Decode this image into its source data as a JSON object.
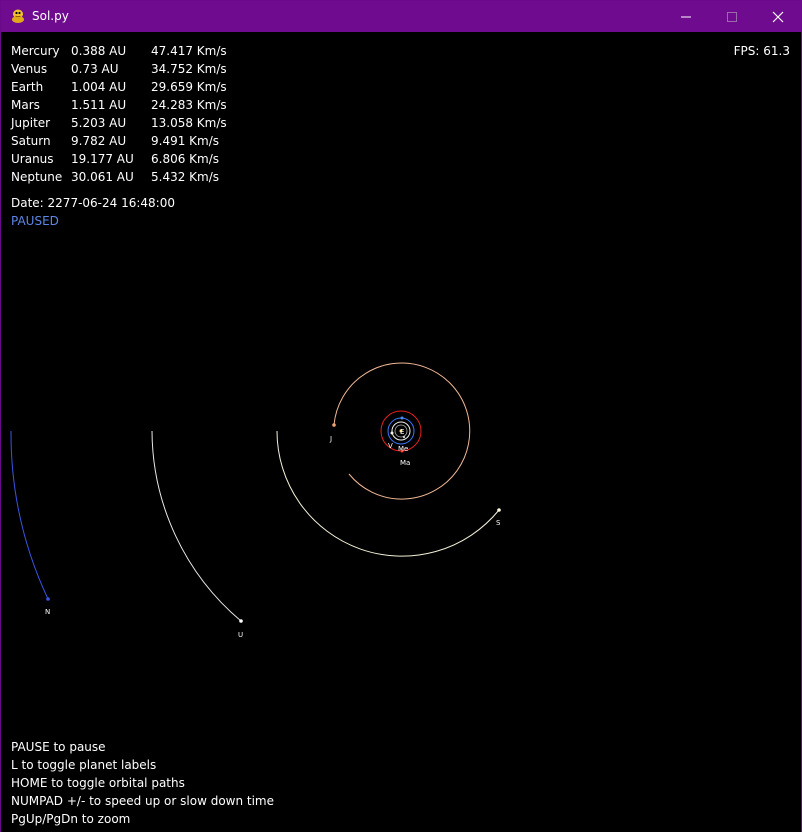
{
  "window": {
    "title": "Sol.py",
    "icon": "python-snake-icon",
    "controls": [
      "minimize",
      "maximize",
      "close"
    ],
    "accent_color": "#6f0b8f"
  },
  "fps_label": "FPS: 61.3",
  "planets": [
    {
      "name": "Mercury",
      "distance": "0.388 AU",
      "velocity": "47.417 Km/s"
    },
    {
      "name": "Venus",
      "distance": "0.73 AU",
      "velocity": "34.752 Km/s"
    },
    {
      "name": "Earth",
      "distance": "1.004 AU",
      "velocity": "29.659 Km/s"
    },
    {
      "name": "Mars",
      "distance": "1.511 AU",
      "velocity": "24.283 Km/s"
    },
    {
      "name": "Jupiter",
      "distance": "5.203 AU",
      "velocity": "13.058 Km/s"
    },
    {
      "name": "Saturn",
      "distance": "9.782 AU",
      "velocity": "9.491 Km/s"
    },
    {
      "name": "Uranus",
      "distance": "19.177 AU",
      "velocity": "6.806 Km/s"
    },
    {
      "name": "Neptune",
      "distance": "30.061 AU",
      "velocity": "5.432 Km/s"
    }
  ],
  "date_label": "Date: 2277-06-24 16:48:00",
  "status": {
    "text": "PAUSED",
    "color": "#5c87e6"
  },
  "map_labels": {
    "sun": "",
    "mercury": "Me",
    "venus": "V",
    "earth": "E",
    "mars": "Ma",
    "jupiter": "J",
    "saturn": "S",
    "uranus": "U",
    "neptune": "N"
  },
  "help": [
    "PAUSE to pause",
    "L to toggle planet labels",
    "HOME to toggle orbital paths",
    "NUMPAD +/- to speed up or slow down time",
    "PgUp/PgDn to zoom"
  ]
}
